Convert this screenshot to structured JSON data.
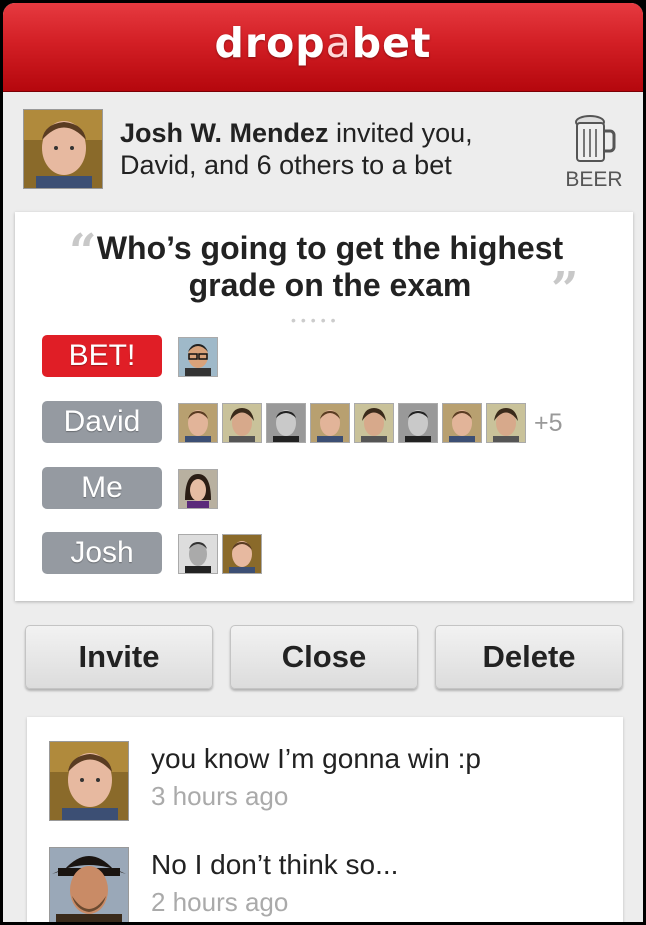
{
  "app": {
    "logo_part1": "drop",
    "logo_part2": "a",
    "logo_part3": "bet"
  },
  "invite": {
    "inviter": "Josh W. Mendez",
    "text_suffix": "invited you,",
    "line2": "David, and 6 others to a bet",
    "stake_icon": "beer-mug-icon",
    "stake_label": "BEER"
  },
  "bet": {
    "question_line1": "Who’s going to get the highest",
    "question_line2": "grade on the exam",
    "rows": [
      {
        "label": "BET!",
        "style": "red"
      },
      {
        "label": "David",
        "style": "gray",
        "more": "+5"
      },
      {
        "label": "Me",
        "style": "gray"
      },
      {
        "label": "Josh",
        "style": "gray"
      }
    ]
  },
  "actions": {
    "invite": "Invite",
    "close": "Close",
    "delete": "Delete"
  },
  "comments": [
    {
      "text": "you know I’m gonna win :p",
      "time": "3 hours ago"
    },
    {
      "text": "No I don’t think so...",
      "time": "2 hours ago"
    }
  ],
  "colors": {
    "brand_red": "#d31f25",
    "pill_gray": "#959aa1",
    "background": "#ededed"
  }
}
